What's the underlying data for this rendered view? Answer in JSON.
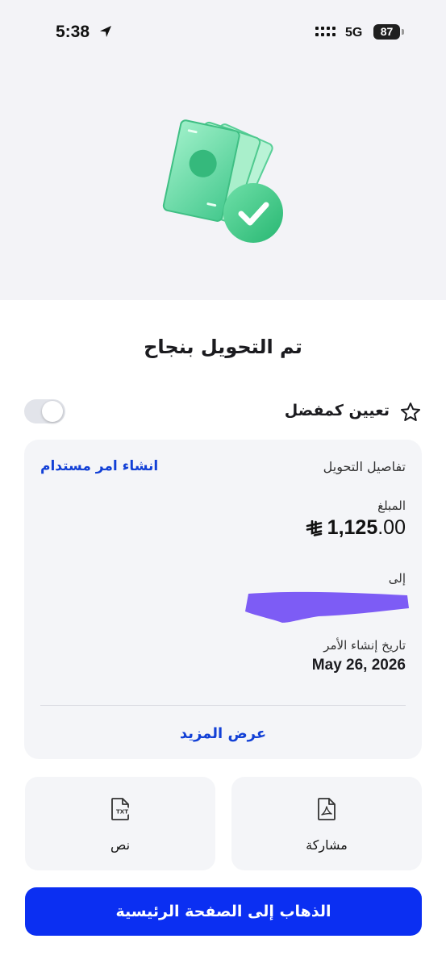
{
  "status_bar": {
    "time": "5:38",
    "network": "5G",
    "battery": "87"
  },
  "title": "تم التحويل بنجاح",
  "favorite": {
    "label": "تعيين كمفضل",
    "enabled": false
  },
  "details": {
    "title": "تفاصيل التحويل",
    "standing_order_link": "انشاء امر مستدام",
    "amount_label": "المبلغ",
    "amount_integer": "1,125",
    "amount_decimal": ".00",
    "currency_icon": "saudi-riyal-icon",
    "to_label": "إلى",
    "date_label": "تاريخ إنشاء الأمر",
    "date_value": "May 26, 2026",
    "more_link": "عرض المزيد"
  },
  "actions": [
    {
      "label": "مشاركة",
      "icon": "pdf-icon"
    },
    {
      "label": "نص",
      "icon": "txt-file-icon"
    }
  ],
  "home_button": "الذهاب إلى الصفحة الرئيسية",
  "colors": {
    "primary": "#0b2ff2",
    "link": "#1240d6",
    "success_green": "#3ccf8e",
    "redaction": "#7d5cf5",
    "card_background": "#f4f5f8",
    "hero_background": "#f3f3f7"
  }
}
